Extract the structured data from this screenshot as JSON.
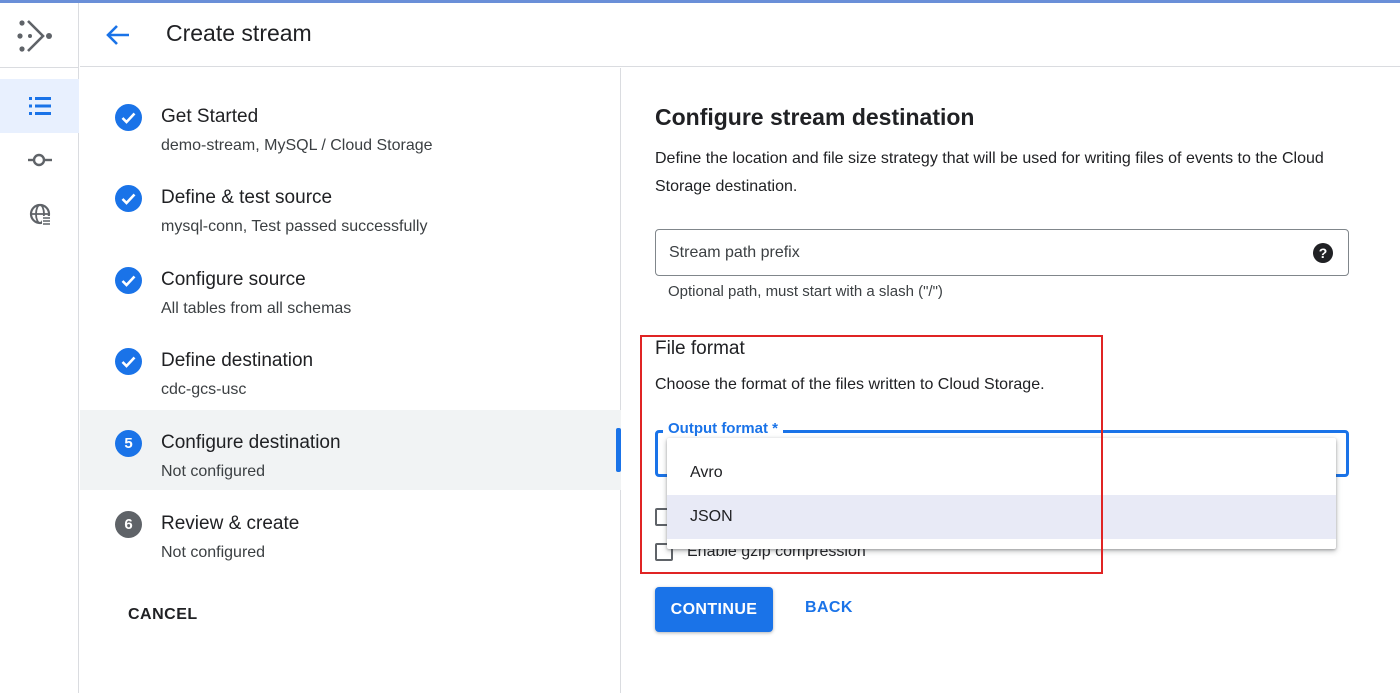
{
  "colors": {
    "accent": "#1a73e8",
    "highlight": "#e02424",
    "selected_option_bg": "#e8eaf6"
  },
  "header": {
    "title": "Create stream",
    "back_icon": "arrow-back-icon"
  },
  "rail": {
    "items": [
      "datastream-logo-icon",
      "list-icon",
      "connection-icon",
      "globe-icon"
    ]
  },
  "steps": [
    {
      "title": "Get Started",
      "subtitle": "demo-stream, MySQL / Cloud Storage",
      "status": "done",
      "icon": "check-icon"
    },
    {
      "title": "Define & test source",
      "subtitle": "mysql-conn, Test passed successfully",
      "status": "done",
      "icon": "check-icon"
    },
    {
      "title": "Configure source",
      "subtitle": "All tables from all schemas",
      "status": "done",
      "icon": "check-icon"
    },
    {
      "title": "Define destination",
      "subtitle": "cdc-gcs-usc",
      "status": "done",
      "icon": "check-icon"
    },
    {
      "title": "Configure destination",
      "subtitle": "Not configured",
      "status": "current",
      "number": "5"
    },
    {
      "title": "Review & create",
      "subtitle": "Not configured",
      "status": "pending",
      "number": "6"
    }
  ],
  "stepper": {
    "cancel_label": "CANCEL"
  },
  "main": {
    "title": "Configure stream destination",
    "description": "Define the location and file size strategy that will be used for writing files of events to the Cloud Storage destination.",
    "path_prefix": {
      "placeholder": "Stream path prefix",
      "hint": "Optional path, must start with a slash (\"/\")",
      "help_icon": "help-icon",
      "help_glyph": "?"
    },
    "file_format": {
      "title": "File format",
      "description": "Choose the format of the files written to Cloud Storage.",
      "select_label": "Output format *",
      "options": [
        "Avro",
        "JSON"
      ],
      "selected_option": "JSON"
    },
    "checkboxes": [
      {
        "label": ""
      },
      {
        "label": "Enable gzip compression"
      }
    ],
    "continue_label": "CONTINUE",
    "back_label": "BACK"
  }
}
